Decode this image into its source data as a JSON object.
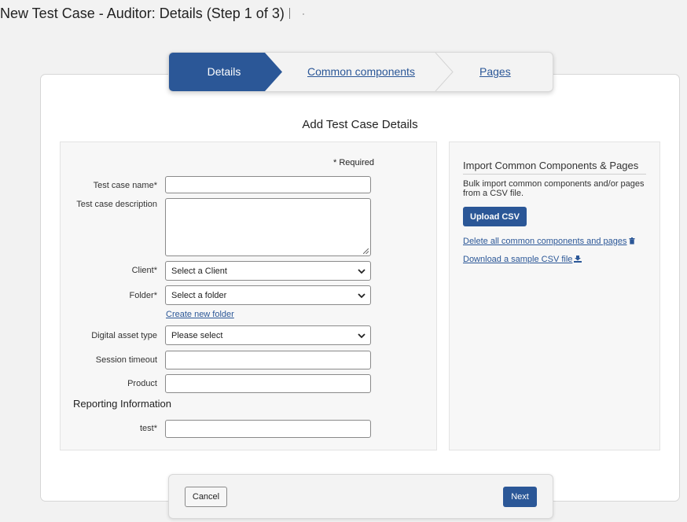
{
  "page": {
    "title": "New Test Case - Auditor: Details (Step 1 of 3)"
  },
  "stepper": {
    "steps": [
      {
        "label": "Details",
        "state": "active"
      },
      {
        "label": "Common components",
        "state": "link"
      },
      {
        "label": "Pages",
        "state": "link"
      }
    ]
  },
  "form": {
    "heading": "Add Test Case Details",
    "required_note": "* Required",
    "fields": {
      "test_case_name": {
        "label": "Test case name*",
        "value": ""
      },
      "test_case_description": {
        "label": "Test case description",
        "value": ""
      },
      "client": {
        "label": "Client*",
        "selected": "Select a Client"
      },
      "folder": {
        "label": "Folder*",
        "selected": "Select a folder"
      },
      "create_folder_link": "Create new folder",
      "digital_asset_type": {
        "label": "Digital asset type",
        "selected": "Please select"
      },
      "session_timeout": {
        "label": "Session timeout",
        "value": ""
      },
      "product": {
        "label": "Product",
        "value": ""
      }
    },
    "reporting": {
      "heading": "Reporting Information",
      "test": {
        "label": "test*",
        "value": ""
      }
    }
  },
  "import": {
    "title": "Import Common Components & Pages",
    "description": "Bulk import common components and/or pages from a CSV file.",
    "upload_button": "Upload CSV",
    "delete_link": "Delete all common components and pages",
    "download_link": "Download a sample CSV file",
    "icons": {
      "delete": "trash-icon",
      "download": "download-icon"
    }
  },
  "footer": {
    "cancel": "Cancel",
    "next": "Next"
  },
  "colors": {
    "accent": "#2b5797",
    "page_bg": "#f2f2f2",
    "panel_bg": "#f7f7f7"
  }
}
